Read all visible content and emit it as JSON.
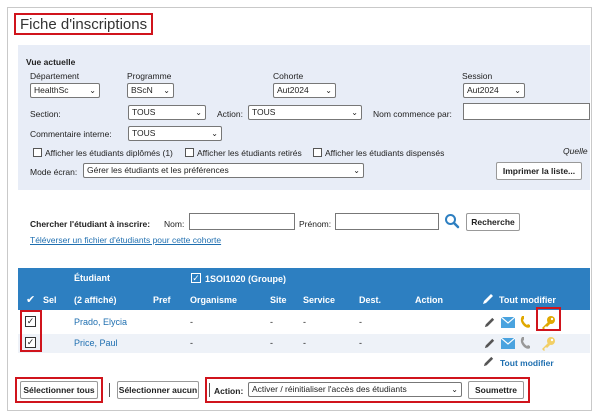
{
  "page": {
    "title": "Fiche d'inscriptions"
  },
  "view": {
    "heading": "Vue actuelle",
    "departement_label": "Département",
    "departement_value": "HealthSc",
    "programme_label": "Programme",
    "programme_value": "BScN",
    "cohorte_label": "Cohorte",
    "cohorte_value": "Aut2024",
    "session_label": "Session",
    "session_value": "Aut2024",
    "section_label": "Section:",
    "section_value": "TOUS",
    "action_label": "Action:",
    "action_value": "TOUS",
    "nom_commence_label": "Nom commence par:",
    "nom_commence_value": "",
    "commentaire_label": "Commentaire interne:",
    "commentaire_value": "TOUS",
    "chk_diplomes": "Afficher les étudiants diplômés (1)",
    "chk_retires": "Afficher les étudiants retirés",
    "chk_dispenses": "Afficher les étudiants dispensés",
    "quelle_partial": "Quelle",
    "mode_label": "Mode écran:",
    "mode_value": "Gérer les étudiants et les préférences",
    "print_button": "Imprimer la liste..."
  },
  "search": {
    "label": "Chercher l'étudiant à inscrire:",
    "nom_label": "Nom:",
    "nom_value": "",
    "prenom_label": "Prénom:",
    "prenom_value": "",
    "search_icon": "search-icon",
    "button": "Recherche",
    "upload_link": "Téléverser un fichier d'étudiants pour cette cohorte"
  },
  "table": {
    "header": {
      "etudiant": "Étudiant",
      "group": "1SOI1020  (Groupe)",
      "sel": "Sel",
      "count": "(2 affiché)",
      "pref": "Pref",
      "organisme": "Organisme",
      "site": "Site",
      "service": "Service",
      "dest": "Dest.",
      "action": "Action",
      "tout_modifier": "Tout modifier"
    },
    "rows": [
      {
        "name": "Prado, Elycia",
        "organisme": "-",
        "site": "-",
        "service": "-",
        "dest": "-",
        "checked": true
      },
      {
        "name": "Price, Paul",
        "organisme": "-",
        "site": "-",
        "service": "-",
        "dest": "-",
        "checked": true
      }
    ],
    "footer_tout_modifier": "Tout modifier"
  },
  "bottom": {
    "select_all": "Sélectionner tous",
    "select_none": "Sélectionner aucun",
    "action_label": "Action:",
    "action_value": "Activer / réinitialiser l'accès des étudiants",
    "submit": "Soumettre"
  },
  "colors": {
    "accent": "#2d7fc1",
    "highlight": "#d0141c",
    "key": "#e0a800",
    "mail": "#4aa3df"
  }
}
